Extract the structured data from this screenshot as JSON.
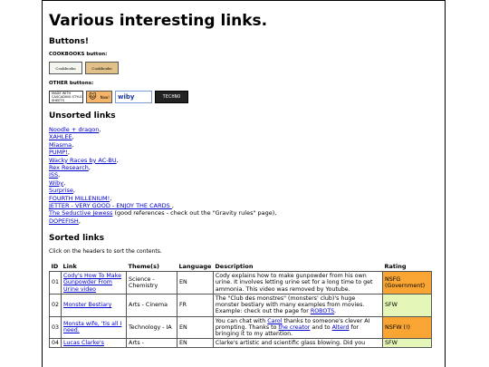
{
  "page": {
    "title": "Various interesting links.",
    "buttons_heading": "Buttons!",
    "cookbooks_label": "COOKBOOKS button:",
    "cookbooks_buttons": [
      {
        "label": "Cookbooks",
        "icon": "cookbooks-badge-light"
      },
      {
        "label": "Cookbooks",
        "icon": "cookbooks-badge-tan"
      }
    ],
    "other_label": "OTHER buttons:",
    "other_buttons": [
      {
        "label": "MADE WITH CASCADING STYLE SHEETS",
        "icon": "css-badge"
      },
      {
        "label": "Now!",
        "icon": "cat-badge"
      },
      {
        "label": "wiby",
        "icon": "wiby-badge"
      },
      {
        "label": "TECHNO",
        "icon": "techno-badge"
      }
    ],
    "unsorted_heading": "Unsorted links",
    "unsorted_links": [
      {
        "text": "Noodle + dragon",
        "suffix": ","
      },
      {
        "text": "XAHLEE",
        "suffix": ","
      },
      {
        "text": "Miasma",
        "suffix": ","
      },
      {
        "text": "PUMP!",
        "suffix": ","
      },
      {
        "text": "Wacky Races by AC-BU",
        "suffix": ","
      },
      {
        "text": "Rex Research",
        "suffix": ","
      },
      {
        "text": "ISS",
        "suffix": ","
      },
      {
        "text": "Wiby",
        "suffix": ","
      },
      {
        "text": "Surprise",
        "suffix": ","
      },
      {
        "text": "FOURTH MILLENIUM!",
        "suffix": ","
      },
      {
        "text": "JETTER - VERY GOOD - ENJOY THE CARDS ",
        "suffix": ","
      },
      {
        "text": "The Seductive Jewess",
        "suffix": " (good references - check out the \"Gravity rules\" page),"
      },
      {
        "text": "DOPEFISH",
        "suffix": ","
      }
    ],
    "sorted_heading": "Sorted links",
    "sorted_note": "Click on the headers to sort the contents.",
    "table": {
      "headers": [
        "ID",
        "Link",
        "Theme(s)",
        "Language",
        "Description",
        "Rating"
      ],
      "rows": [
        {
          "id": "01",
          "link": "Cody's How To Make Gunpowder From Urine video",
          "theme": "Science - Chemistry",
          "language": "EN",
          "description": "Cody explains how to make gunpowder from his own urine. It involves letting urine set for a long time to get ammonia. This video was removed by Youtube.",
          "rating": "NSFG (Government)",
          "rating_color": "#f8a533"
        },
        {
          "id": "02",
          "link": "Monster Bestiary",
          "theme": "Arts - Cinema",
          "language": "FR",
          "description_pre": "The \"Club des monstres\" (monsters' club)'s huge monster bestiary with many examples from movies. Example: check out the page for ",
          "description_link": "ROBOTS",
          "description_post": ".",
          "rating": "SFW",
          "rating_color": "#e5f7b8"
        },
        {
          "id": "03",
          "link": "Monsta wife, 'tis all I need.",
          "theme": "Technology - IA",
          "language": "EN",
          "desc_a": "You can chat with ",
          "desc_link1": "Carol",
          "desc_b": " thanks to someone's clever AI prompting. Thanks to ",
          "desc_link2": "the creator",
          "desc_c": " and to ",
          "desc_link3": "Alterd",
          "desc_d": " for bringing it to my attention.",
          "rating": "NSFW (!)",
          "rating_color": "#f8a533"
        },
        {
          "id": "04",
          "link": "Lucas Clarke's",
          "theme": "Arts -",
          "language": "EN",
          "description": "Clarke's artistic and scientific glass blowing. Did you",
          "rating": "SFW",
          "rating_color": "#e5f7b8"
        }
      ]
    }
  }
}
